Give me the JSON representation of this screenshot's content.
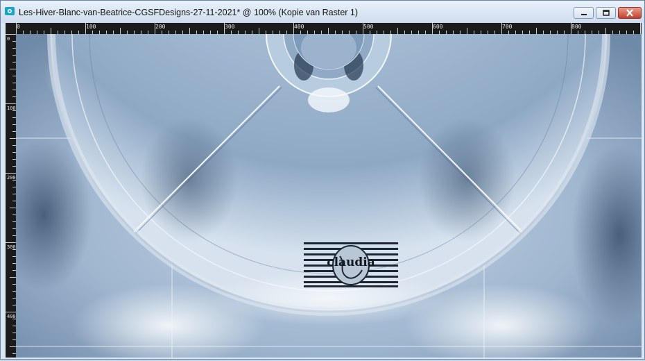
{
  "window": {
    "title": "Les-Hiver-Blanc-van-Beatrice-CGSFDesigns-27-11-2021* @ 100% (Kopie van Raster 1)",
    "controls": {
      "minimize": "minimize-icon",
      "maximize": "maximize-icon",
      "close": "close-icon"
    }
  },
  "ruler": {
    "h_labels": [
      "0",
      "100",
      "200",
      "300",
      "400",
      "500",
      "600",
      "700",
      "800"
    ],
    "v_labels": [
      "0",
      "100",
      "200",
      "300",
      "400"
    ]
  },
  "canvas": {
    "watermark_text": "claudia",
    "colors": {
      "steel": "#9fb6cf",
      "light": "#e8eff7",
      "dark": "#3e5877"
    }
  }
}
